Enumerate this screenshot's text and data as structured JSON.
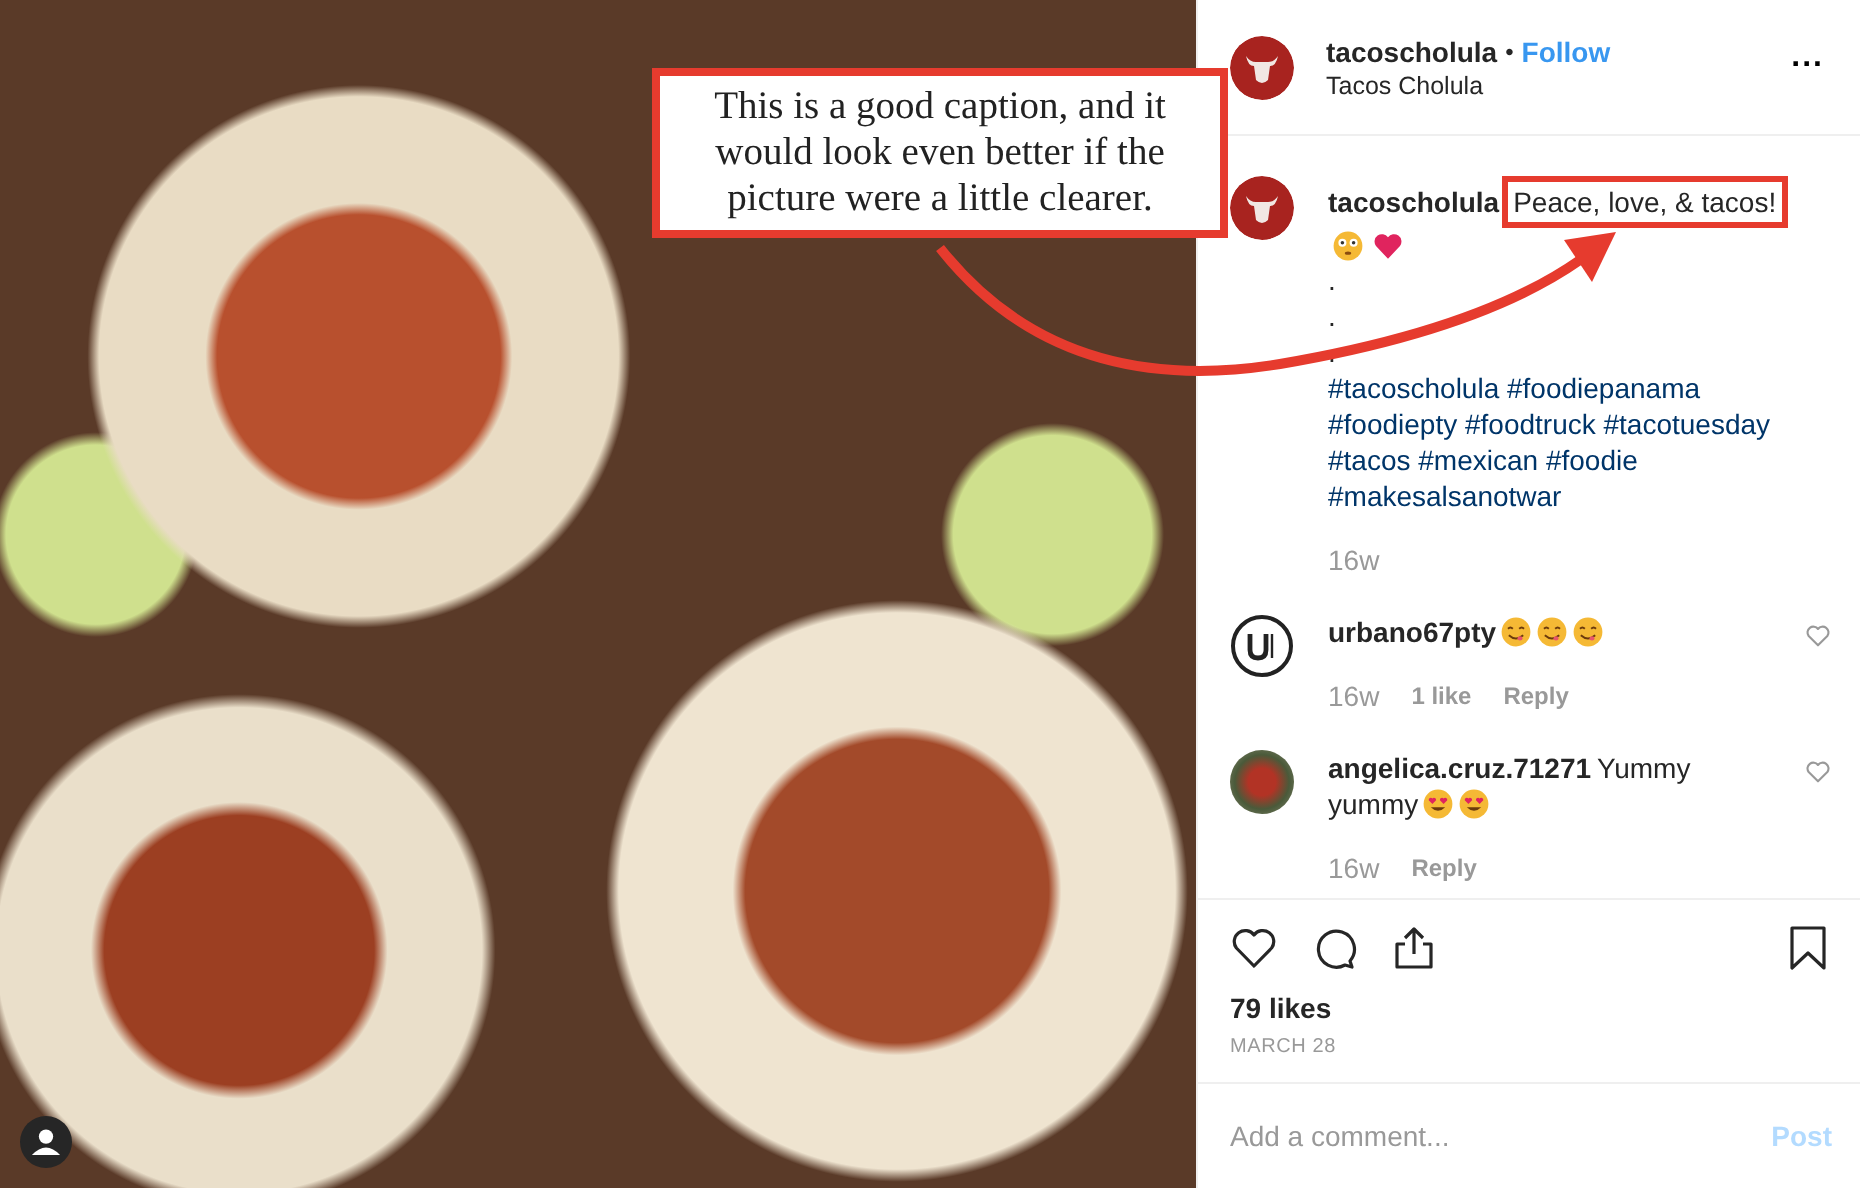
{
  "annotation": {
    "text": "This is a good caption, and it would look even better if the picture were a little clearer."
  },
  "header": {
    "username": "tacoscholula",
    "separator": "•",
    "follow": "Follow",
    "subtitle": "Tacos Cholula",
    "more": "..."
  },
  "caption": {
    "username": "tacoscholula",
    "text": "Peace, love, & tacos!",
    "highlighted": true,
    "emoji": [
      {
        "kind": "flushed"
      },
      {
        "kind": "heart"
      }
    ],
    "dots": [
      ".",
      ".",
      "."
    ],
    "hashtag_lines": [
      "#tacoscholula #foodiepanama",
      "#foodiepty #foodtruck #tacotuesday",
      "#tacos #mexican #foodie",
      "#makesalsanotwar"
    ],
    "time": "16w"
  },
  "comments": [
    {
      "username": "urbano67pty",
      "kind": "logo",
      "emoji": [
        {
          "kind": "yum"
        },
        {
          "kind": "yum"
        },
        {
          "kind": "yum"
        }
      ],
      "time": "16w",
      "likes": "1 like",
      "reply": "Reply"
    },
    {
      "username": "angelica.cruz.71271",
      "text_lines": [
        "Yummy",
        "yummy"
      ],
      "kind": "photo",
      "emoji": [
        {
          "kind": "hearteyes"
        },
        {
          "kind": "hearteyes"
        }
      ],
      "time": "16w",
      "reply": "Reply"
    }
  ],
  "likes": "79 likes",
  "date": "MARCH 28",
  "comment_box": {
    "placeholder": "Add a comment...",
    "post": "Post"
  }
}
